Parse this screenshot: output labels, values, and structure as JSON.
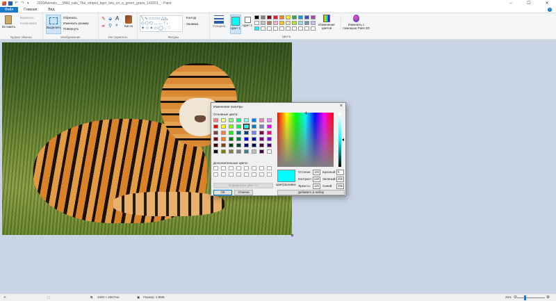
{
  "window": {
    "title": "2020Animals___Wild_cats_The_striped_tiger_lies_on_a_green_grass_143201_ - Paint",
    "controls": [
      "–",
      "☐",
      "✕"
    ]
  },
  "tabs": [
    {
      "label": "Файл"
    },
    {
      "label": "Главная"
    },
    {
      "label": "Вид"
    }
  ],
  "ribbon": {
    "clipboard": {
      "paste_label": "Вставить",
      "cut_label": "Вырезать",
      "copy_label": "Копировать",
      "group_label": "Буфер обмена"
    },
    "image": {
      "select_label": "Выделить",
      "crop_label": "Обрезать",
      "resize_label": "Изменить размер",
      "rotate_label": "Повернуть",
      "group_label": "Изображение"
    },
    "tools": {
      "brushes_label": "Кисти",
      "group_label": "Инструменты"
    },
    "shapes": {
      "outline_label": "Контур",
      "fill_label": "Заливка",
      "group_label": "Фигуры"
    },
    "size_label": "Толщина",
    "color1_label": "Цвет 1",
    "color2_label": "Цвет 2",
    "edit_colors_label": "Изменение цветов",
    "paint3d_label": "Изменить с помощью Paint 3D",
    "colors_group_label": "Цвета",
    "colors": {
      "color1": "#00ffff",
      "color2": "#ffffff"
    },
    "palette_row1": [
      "#000000",
      "#7f7f7f",
      "#880015",
      "#ed1c24",
      "#ff7f27",
      "#fff200",
      "#22b14c",
      "#00a2e8",
      "#3f48cc",
      "#a349a4"
    ],
    "palette_row2": [
      "#ffffff",
      "#c3c3c3",
      "#b97a57",
      "#ffaec9",
      "#ffc90e",
      "#efe4b0",
      "#b5e61d",
      "#99d9ea",
      "#7092be",
      "#c8bfe7"
    ],
    "palette_row3": [
      "#00ffff",
      "#ffffff",
      "#ffffff",
      "#ffffff",
      "#ffffff",
      "#ffffff",
      "#ffffff",
      "#ffffff",
      "#ffffff",
      "#ffffff"
    ]
  },
  "dialog": {
    "title": "Изменение палитры",
    "basic_colors_label": "Основные цвета:",
    "custom_colors_label": "Дополнительные цвета:",
    "define_custom_button": "Определить цвет >>",
    "ok_button": "ОК",
    "cancel_button": "Отмена",
    "color_solid_label": "Цвет|Заливка",
    "hue_label": "Оттенок:",
    "hue": "120",
    "sat_label": "Контраст:",
    "sat": "240",
    "lum_label": "Яркость:",
    "lum": "120",
    "red_label": "Красный:",
    "red": "0",
    "green_label": "Зеленый:",
    "green": "255",
    "blue_label": "Синий:",
    "blue": "255",
    "add_to_custom_button": "Добавить в набор",
    "basic_colors": [
      "#ff8080",
      "#ffff80",
      "#80ff80",
      "#00ff80",
      "#80ffff",
      "#0080ff",
      "#ff80c0",
      "#ff80ff",
      "#ff0000",
      "#ffff00",
      "#80ff00",
      "#00ff40",
      "#00ffff",
      "#0080c0",
      "#8080c0",
      "#ff00ff",
      "#804040",
      "#ff8040",
      "#00ff00",
      "#008080",
      "#004080",
      "#8080ff",
      "#800040",
      "#ff0080",
      "#800000",
      "#ff8000",
      "#008000",
      "#008040",
      "#0000ff",
      "#0000a0",
      "#800080",
      "#8000ff",
      "#400000",
      "#804000",
      "#004000",
      "#004040",
      "#000080",
      "#000040",
      "#400040",
      "#400080",
      "#000000",
      "#808000",
      "#808040",
      "#808080",
      "#408080",
      "#c0c0c0",
      "#400040",
      "#ffffff"
    ]
  },
  "status": {
    "dimensions": "4000 × 2667пкс",
    "size": "Размер: 2,9МБ",
    "zoom": "25%"
  }
}
